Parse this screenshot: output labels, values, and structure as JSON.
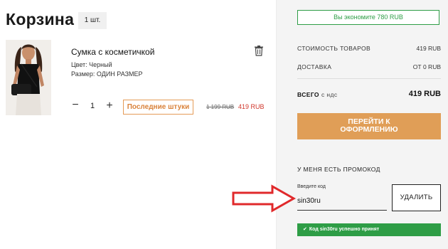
{
  "cart": {
    "title": "Корзина",
    "count_badge": "1 шт."
  },
  "item": {
    "name": "Сумка с косметичкой",
    "color": "Цвет: Черный",
    "size": "Размер: ОДИН РАЗМЕР",
    "quantity": "1",
    "minus_label": "−",
    "plus_label": "+",
    "badge": "Последние штуки",
    "old_price": "1 199 RUB",
    "price": "419 RUB"
  },
  "summary": {
    "savings": "Вы экономите 780 RUB",
    "goods_label": "СТОИМОСТЬ ТОВАРОВ",
    "goods_value": "419 RUB",
    "delivery_label": "ДОСТАВКА",
    "delivery_value": "ОТ 0 RUB",
    "total_label": "ВСЕГО",
    "total_note": "с ндс",
    "total_value": "419 RUB",
    "checkout_label": "ПЕРЕЙТИ К\nОФОРМЛЕНИЮ"
  },
  "promo": {
    "title": "У МЕНЯ ЕСТЬ ПРОМОКОД",
    "input_hint": "Введите код",
    "input_value": "sin30ru",
    "delete_label": "УДАЛИТЬ",
    "success_check": "✔",
    "success_text": "Код sin30ru успешно принят"
  },
  "colors": {
    "accent_orange": "#e09e57",
    "price_red": "#d0362b",
    "success_green": "#2e9d46",
    "arrow_red": "#e0292b"
  },
  "icons": [
    "trash-icon",
    "check-icon",
    "arrow-annotation"
  ]
}
